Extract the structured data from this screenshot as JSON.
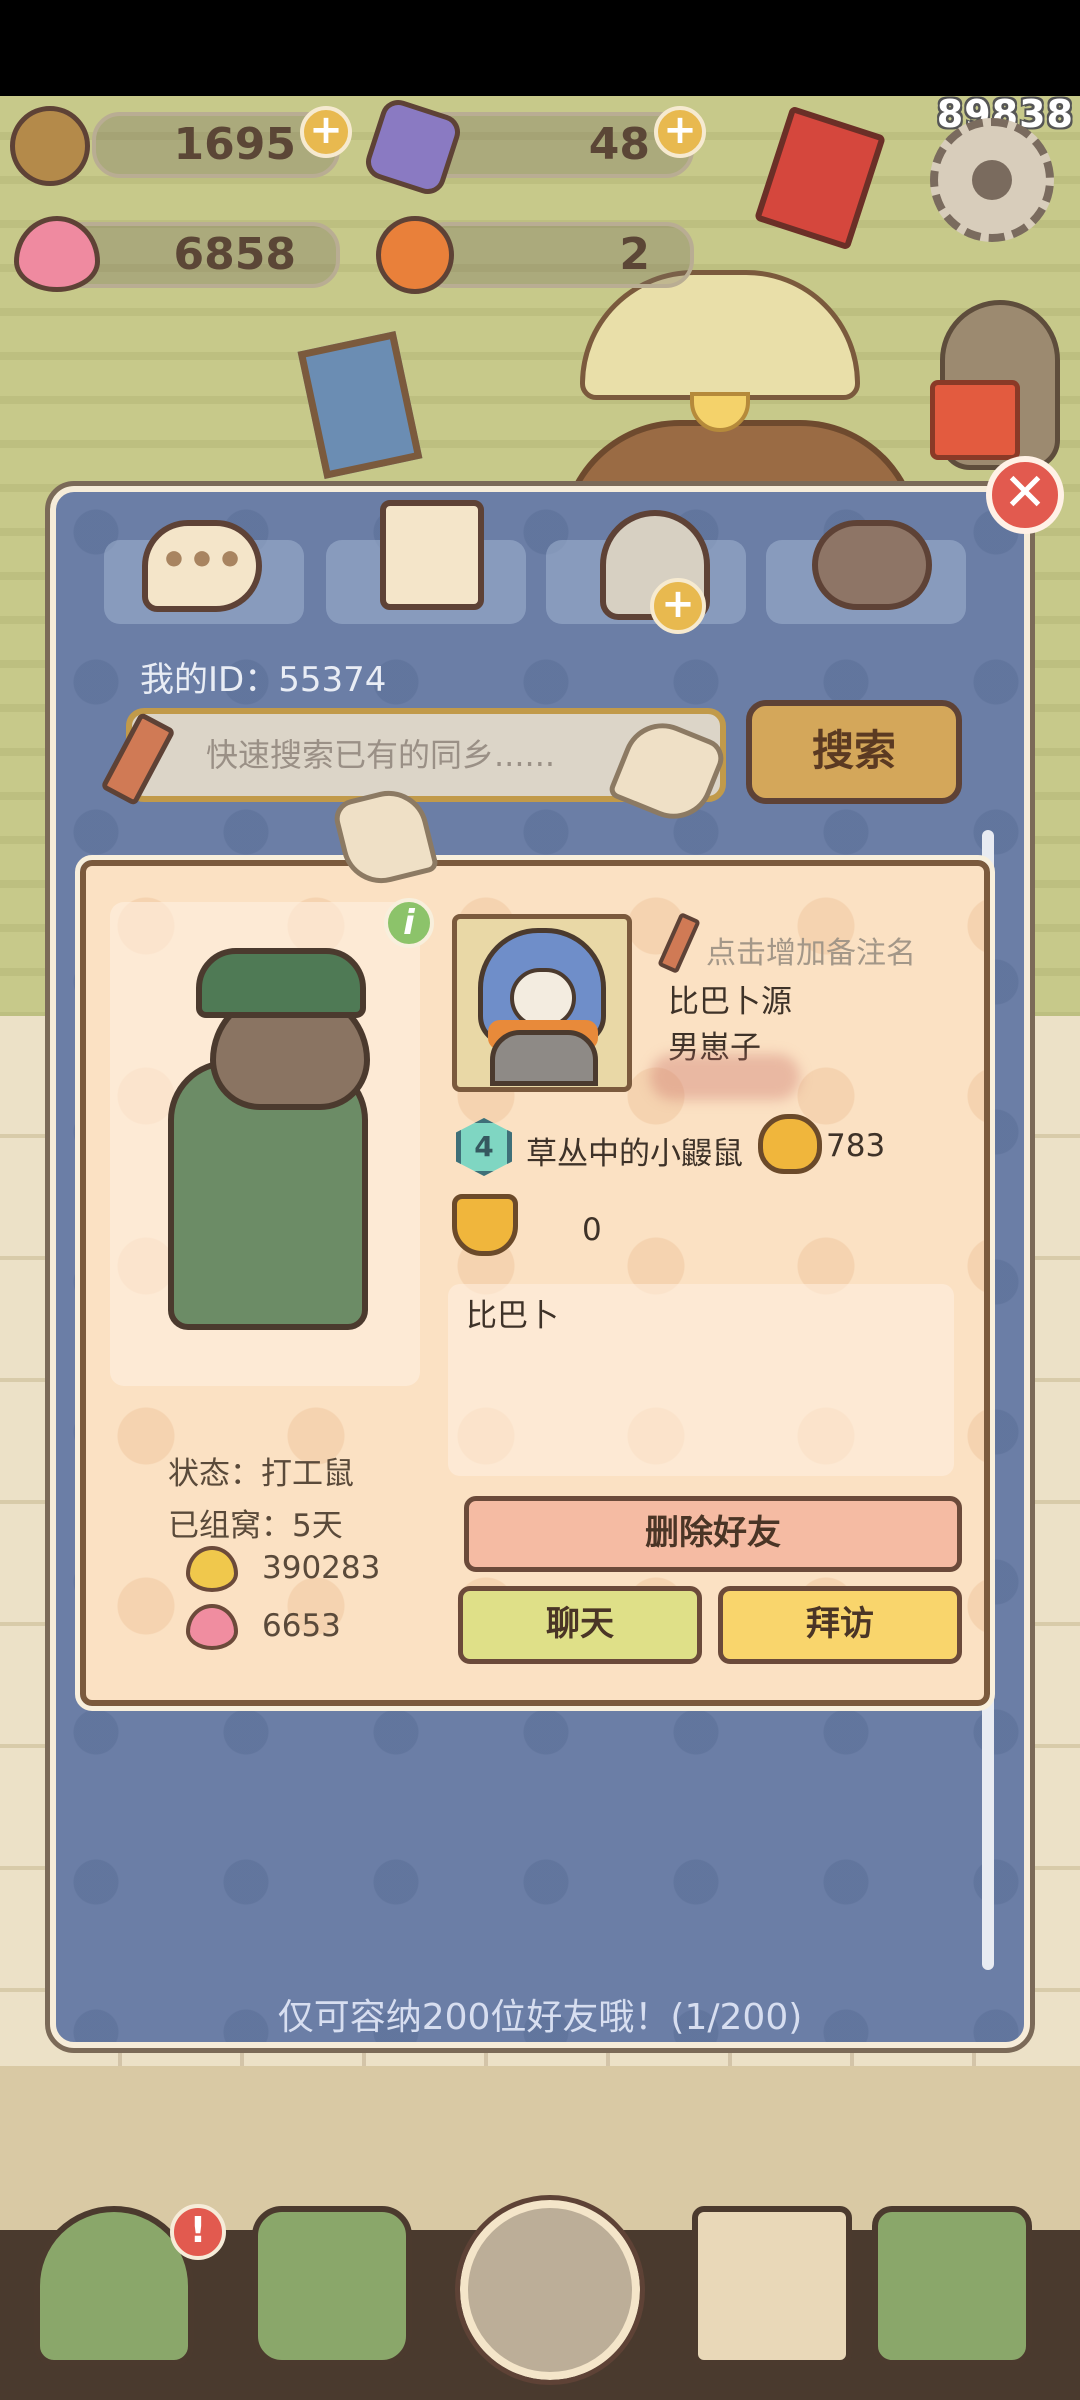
{
  "overlay": {
    "score": "89838"
  },
  "resources": {
    "acorn": "1695",
    "crystal": "48",
    "heart": "6858",
    "orange": "2"
  },
  "tabs": [
    {
      "name": "chat",
      "icon": "speech-bubble-icon"
    },
    {
      "name": "contacts",
      "icon": "contact-book-icon"
    },
    {
      "name": "add-friend",
      "icon": "add-friend-icon"
    },
    {
      "name": "friends",
      "icon": "otters-icon"
    }
  ],
  "my_id": "我的ID：55374",
  "search": {
    "placeholder": "快速搜索已有的同乡......",
    "button_label": "搜索"
  },
  "friend_card": {
    "remark_hint": "点击增加备注名",
    "nickname": "比巴卜源",
    "gender": "男崽子",
    "level": "4",
    "level_title": "草丛中的小鼹鼠",
    "bells": "783",
    "trophies": "0",
    "bio": "比巴卜",
    "status": "状态：打工鼠",
    "nest_days": "已组窝：5天",
    "gold_hearts": "390283",
    "pink_hearts": "6653",
    "delete_label": "删除好友",
    "chat_label": "聊天",
    "visit_label": "拜访"
  },
  "capacity_note": "仅可容纳200位好友哦！(1/200)",
  "colors": {
    "panel": "#6b7ea6",
    "card": "#fbe1c3",
    "accent_gold": "#d4a75a",
    "delete": "#f5bba3",
    "chat": "#dfe088",
    "visit": "#f9d56c"
  },
  "bottom_nav": [
    {
      "name": "home",
      "icon": "house-icon",
      "badge": "!"
    },
    {
      "name": "mail",
      "icon": "mail-icon"
    },
    {
      "name": "friends",
      "icon": "otters-icon"
    },
    {
      "name": "tasks",
      "icon": "clipboard-icon"
    },
    {
      "name": "map",
      "icon": "map-icon"
    }
  ]
}
